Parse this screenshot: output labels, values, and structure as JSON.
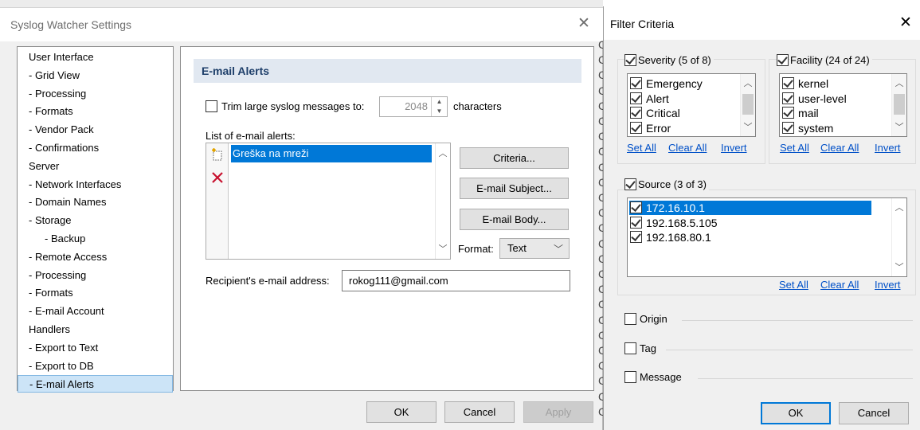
{
  "settings_dialog": {
    "title": "Syslog Watcher Settings",
    "close_glyph": "✕",
    "nav_items": [
      {
        "label": "User Interface",
        "indent": 0
      },
      {
        "label": "- Grid View",
        "indent": 1
      },
      {
        "label": "- Processing",
        "indent": 1
      },
      {
        "label": "- Formats",
        "indent": 1
      },
      {
        "label": "- Vendor Pack",
        "indent": 1
      },
      {
        "label": "- Confirmations",
        "indent": 1
      },
      {
        "label": "Server",
        "indent": 0
      },
      {
        "label": "- Network Interfaces",
        "indent": 1
      },
      {
        "label": "- Domain Names",
        "indent": 1
      },
      {
        "label": "- Storage",
        "indent": 1
      },
      {
        "label": "- Backup",
        "indent": 2
      },
      {
        "label": "- Remote Access",
        "indent": 1
      },
      {
        "label": "- Processing",
        "indent": 1
      },
      {
        "label": "- Formats",
        "indent": 1
      },
      {
        "label": "- E-mail Account",
        "indent": 1
      },
      {
        "label": "Handlers",
        "indent": 0
      },
      {
        "label": "- Export to Text",
        "indent": 1
      },
      {
        "label": "- Export to DB",
        "indent": 1
      },
      {
        "label": "- E-mail Alerts",
        "indent": 1,
        "selected": true
      }
    ],
    "panel": {
      "header": "E-mail Alerts",
      "trim_label": "Trim large syslog messages to:",
      "trim_value": "2048",
      "trim_unit": "characters",
      "list_label": "List of e-mail alerts:",
      "alerts": [
        "Greška na mreži"
      ],
      "criteria_button": "Criteria...",
      "subject_button": "E-mail Subject...",
      "body_button": "E-mail Body...",
      "format_label": "Format:",
      "format_value": "Text",
      "recipient_label": "Recipient's e-mail address:",
      "recipient_value": "rokog111@gmail.com"
    },
    "buttons": {
      "ok": "OK",
      "cancel": "Cancel",
      "apply": "Apply"
    }
  },
  "filter_dialog": {
    "title": "Filter Criteria",
    "close_glyph": "✕",
    "severity": {
      "legend": "Severity (5 of 8)",
      "items": [
        "Emergency",
        "Alert",
        "Critical",
        "Error"
      ]
    },
    "facility": {
      "legend": "Facility (24 of 24)",
      "items": [
        "kernel",
        "user-level",
        "mail",
        "system"
      ]
    },
    "source": {
      "legend": "Source (3 of 3)",
      "items": [
        "172.16.10.1",
        "192.168.5.105",
        "192.168.80.1"
      ]
    },
    "links": {
      "set_all": "Set All",
      "clear_all": "Clear All",
      "invert": "Invert"
    },
    "origin_label": "Origin",
    "tag_label": "Tag",
    "message_label": "Message",
    "buttons": {
      "ok": "OK",
      "cancel": "Cancel"
    }
  },
  "colors": {
    "selection": "#0078d7",
    "panel_header": "#e1e8f1",
    "link": "#0050c8"
  }
}
